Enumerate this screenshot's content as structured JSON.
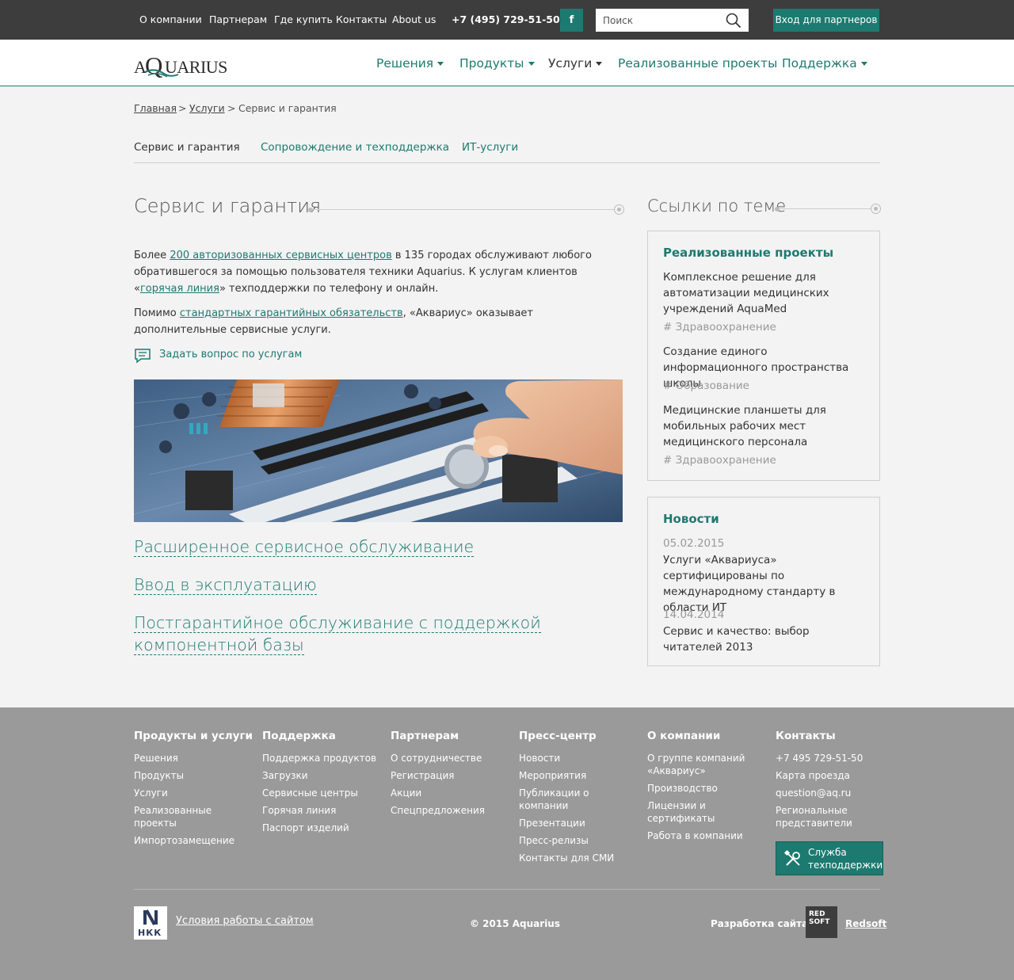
{
  "topbar": {
    "links": [
      "О компании",
      "Партнерам",
      "Где купить",
      "Контакты",
      "About us"
    ],
    "phone": "+7 (495) 729-51-50",
    "social": "f",
    "search_placeholder": "Поиск",
    "partner_login": "Вход для партнеров"
  },
  "header": {
    "logo_text": "AQUARIUS",
    "nav": [
      {
        "label": "Решения"
      },
      {
        "label": "Продукты"
      },
      {
        "label": "Услуги"
      },
      {
        "label": "Реализованные проекты"
      },
      {
        "label": "Поддержка"
      }
    ]
  },
  "breadcrumb": {
    "items": [
      "Главная",
      "Услуги",
      "Сервис и гарантия"
    ],
    "separator": ">"
  },
  "subtabs": [
    "Сервис и гарантия",
    "Сопровождение и техподдержка",
    "ИТ-услуги"
  ],
  "main": {
    "title": "Сервис и гарантия",
    "p1_a": "Более ",
    "p1_link1": "200 авторизованных сервисных центров",
    "p1_b": " в 135 городах обслуживают любого обратившегося за помощью пользователя техники Aquarius. К услугам клиентов «",
    "p1_link2": "горячая линия",
    "p1_c": "» техподдержки по телефону и онлайн.",
    "p2_a": "Помимо ",
    "p2_link": "стандартных гарантийных обязательств",
    "p2_b": ", «Аквариус» оказывает дополнительные сервисные услуги.",
    "ask": "Задать вопрос по услугам",
    "links": [
      "Расширенное сервисное обслуживание",
      "Ввод в эксплуатацию",
      "Постгарантийное обслуживание с поддержкой компонентной базы"
    ]
  },
  "sidebar": {
    "title": "Ссылки по теме",
    "projects": {
      "title": "Реализованные проекты",
      "items": [
        {
          "text": "Комплексное решение для автоматизации медицинских учреждений AquaMed",
          "tag": "# Здравоохранение"
        },
        {
          "text": "Создание единого информационного пространства школы",
          "tag": "# Образование"
        },
        {
          "text": "Медицинские планшеты для мобильных рабочих мест медицинского персонала",
          "tag": "# Здравоохранение"
        }
      ]
    },
    "news": {
      "title": "Новости",
      "items": [
        {
          "date": "05.02.2015",
          "text": "Услуги «Аквариуса» сертифицированы по международному стандарту в области ИТ"
        },
        {
          "date": "14.04.2014",
          "text": "Сервис и качество: выбор читателей 2013"
        }
      ]
    }
  },
  "footer": {
    "columns": [
      {
        "title": "Продукты и услуги",
        "links": [
          "Решения",
          "Продукты",
          "Услуги",
          "Реализованные проекты",
          "Импортозамещение"
        ]
      },
      {
        "title": "Поддержка",
        "links": [
          "Поддержка продуктов",
          "Загрузки",
          "Сервисные центры",
          "Горячая линия",
          "Паспорт изделий"
        ]
      },
      {
        "title": "Партнерам",
        "links": [
          "О сотрудничестве",
          "Регистрация",
          "Акции",
          "Спецпредложения"
        ]
      },
      {
        "title": "Пресс-центр",
        "links": [
          "Новости",
          "Мероприятия",
          "Публикации о компании",
          "Презентации",
          "Пресс-релизы",
          "Контакты для СМИ"
        ]
      },
      {
        "title": "О компании",
        "links": [
          "О группе компаний «Аквариус»",
          "Производство",
          "Лицензии и сертификаты",
          "Работа в компании"
        ]
      },
      {
        "title": "Контакты",
        "links": [
          "+7 495 729-51-50",
          "Карта проезда",
          "question@aq.ru",
          "Региональные представители"
        ]
      }
    ],
    "support_button": "Служба техподдержки",
    "hkk_label": "НКК",
    "terms": "Условия работы с сайтом",
    "copyright": "© 2015 Aquarius",
    "dev_label": "Разработка сайта —",
    "redsoft_logo": "RED SOFT",
    "redsoft_link": "Redsoft"
  },
  "colors": {
    "accent": "#1d7a70",
    "topbar": "#3d3d3d",
    "footer": "#9a9a9a",
    "page": "#f3f3f3"
  }
}
